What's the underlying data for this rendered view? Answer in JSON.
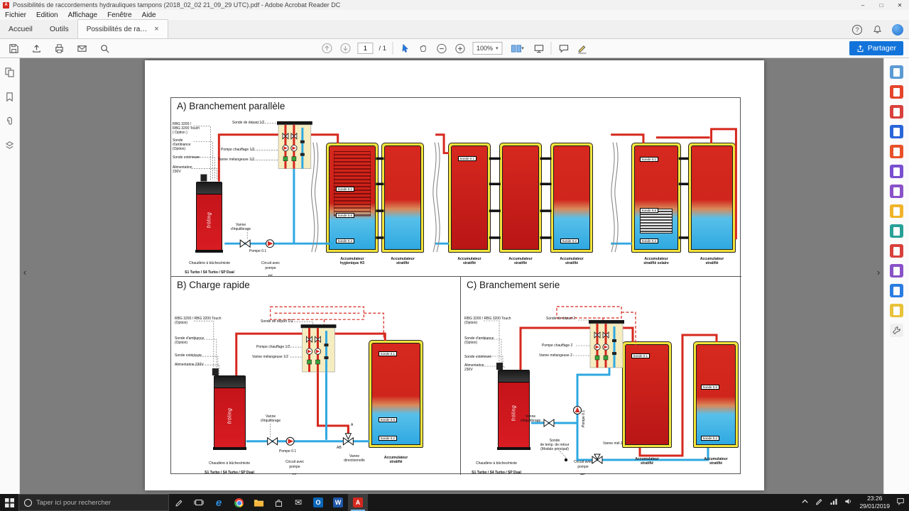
{
  "window": {
    "title": "Possibilités de raccordements hydrauliques tampons (2018_02_02 21_09_29 UTC).pdf - Adobe Acrobat Reader DC"
  },
  "glyphs": {
    "minimize": "–",
    "restore": "□",
    "close": "✕",
    "tab_close": "×",
    "help": "?",
    "dropdown": "▾",
    "chevron_left": "‹",
    "chevron_right": "›",
    "envelope": "✉",
    "edge": "e",
    "outlook": "O",
    "word": "W",
    "acrobat_a": "A"
  },
  "menubar": {
    "items": [
      "Fichier",
      "Edition",
      "Affichage",
      "Fenêtre",
      "Aide"
    ]
  },
  "tabs": {
    "home": "Accueil",
    "tools": "Outils",
    "doc": "Possibilités de racco..."
  },
  "toolbar": {
    "page": "1",
    "total": "/ 1",
    "zoom": "100%",
    "share": "Partager"
  },
  "taskbar": {
    "search": "Taper ici pour rechercher",
    "time": "23:26",
    "date": "29/01/2019"
  },
  "shared": {
    "froling": "fröling",
    "chaud1": "Chaudière à bûches/mixte",
    "chaud2": "S1 Turbo / S4 Turbo / SP Dual",
    "circuit": "Circuit avec\npompe",
    "fe": "FE",
    "me": "ME",
    "acc_strat": "Accumulateur\nstratifié",
    "acc_hyg": "Accumulateur\nhygienique H3",
    "acc_solar": "Accumulateur\nstratifié solaire",
    "s01": "Sonde 0.1",
    "s06": "Sonde 0.6",
    "s02": "Sonde 0.2",
    "vanne_eq": "Vanne\nd'équilibrage",
    "pompe01": "Pompe 0.1",
    "rbg_a": "RBG 3200 /\nRBG 3200 Touch\n( Option )",
    "rbg_bc": "RBG 3200 / RBG 3200 Touch\n(Option)",
    "amb_a": "Sonde\nd'ambiance\n(Option)",
    "amb_bc": "Sonde d'ambiance\n(Option)",
    "ext": "Sonde extérieure",
    "alim2": "Alimentation\n230V",
    "alim1": "Alimentation 230V"
  },
  "a": {
    "title": "A) Branchement parallèle",
    "depart": "Sonde de départ 1/2",
    "pompe": "Pompe chauffage 1/2",
    "vanne": "Vanne mélangeuse 1/2"
  },
  "b": {
    "title": "B) Charge rapide",
    "depart": "Sonde de départ 1/2",
    "pompe": "Pompe chauffage 1/2",
    "vanne": "Vanne mélangeuse 1/2",
    "dir": "Vanne\ndirectionnelle",
    "pa": "A",
    "pab": "AB"
  },
  "c": {
    "title": "C) Branchement serie",
    "depart": "Sonde de départ 2",
    "pompe": "Pompe chauffage 2",
    "vanne": "Vanne mélangeuse 2",
    "retour": "Sonde\nde temp. de retour\n(Module principal)",
    "mel1": "Vanne mél.1"
  }
}
